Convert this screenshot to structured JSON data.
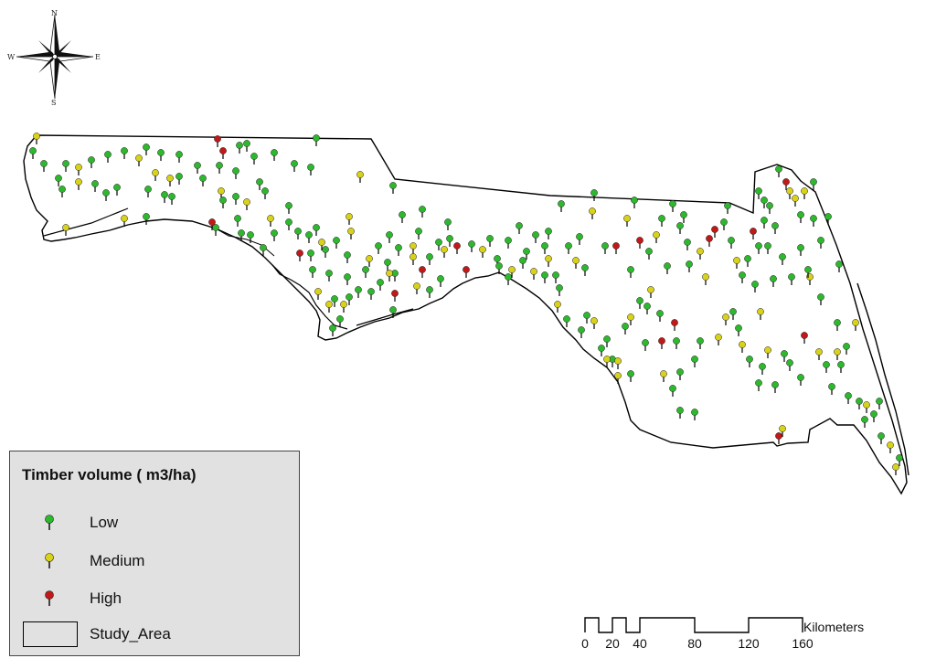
{
  "compass": {
    "north": "N",
    "south": "S",
    "east": "E",
    "west": "W",
    "icon": "compass-rose-icon"
  },
  "legend": {
    "title": "Timber volume ( m3/ha)",
    "items": [
      {
        "label": "Low",
        "color": "#2db82d",
        "icon": "map-pin-icon"
      },
      {
        "label": "Medium",
        "color": "#d8d21a",
        "icon": "map-pin-icon"
      },
      {
        "label": "High",
        "color": "#c21818",
        "icon": "map-pin-icon"
      }
    ],
    "area_label": "Study_Area"
  },
  "scale": {
    "unit": "Kilometers",
    "ticks": [
      "0",
      "20",
      "40",
      "80",
      "120",
      "160"
    ]
  },
  "colors": {
    "low": "#2db82d",
    "medium": "#d8d21a",
    "high": "#c21818",
    "outline": "#000000",
    "legend_bg": "#e1e1e1"
  }
}
